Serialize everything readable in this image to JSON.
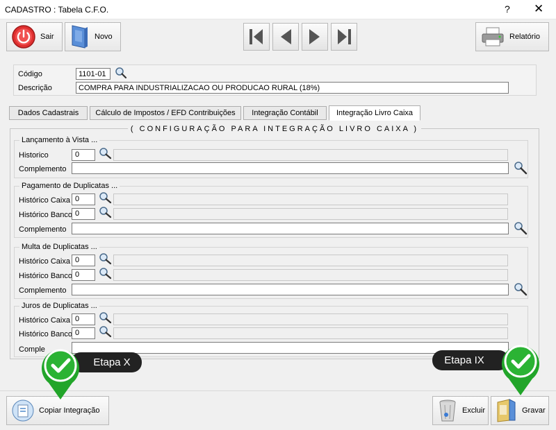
{
  "window": {
    "title": "CADASTRO : Tabela C.F.O.",
    "help_glyph": "?",
    "close_glyph": "✕"
  },
  "toolbar": {
    "sair_label": "Sair",
    "novo_label": "Novo",
    "relatorio_label": "Relatório"
  },
  "header": {
    "codigo_label": "Código",
    "codigo_value": "1101-01",
    "descricao_label": "Descrição",
    "descricao_value": "COMPRA PARA INDUSTRIALIZACAO OU PRODUCAO RURAL (18%)"
  },
  "tabs": [
    {
      "label": "Dados Cadastrais"
    },
    {
      "label": "Cálculo de Impostos / EFD Contribuições"
    },
    {
      "label": "Integração Contábil"
    },
    {
      "label": "Integração Livro Caixa"
    }
  ],
  "config_title": "( CONFIGURAÇÃO PARA INTEGRAÇÃO LIVRO CAIXA )",
  "groups": {
    "vista": {
      "title": "Lançamento à Vista ...",
      "historico_label": "Historico",
      "historico_value": "0",
      "complemento_label": "Complemento"
    },
    "pagamento": {
      "title": "Pagamento de Duplicatas ...",
      "caixa_label": "Histórico Caixa",
      "caixa_value": "0",
      "banco_label": "Histórico Banco",
      "banco_value": "0",
      "complemento_label": "Complemento"
    },
    "multa": {
      "title": "Multa de Duplicatas ...",
      "caixa_label": "Histórico Caixa",
      "caixa_value": "0",
      "banco_label": "Histórico Banco",
      "banco_value": "0",
      "complemento_label": "Complemento"
    },
    "juros": {
      "title": "Juros de Duplicatas ...",
      "caixa_label": "Histórico Caixa",
      "caixa_value": "0",
      "banco_label": "Histórico Banco",
      "banco_value": "0",
      "complemento_label": "Comple"
    }
  },
  "footer": {
    "copiar_label": "Copiar Integração",
    "excluir_label": "Excluir",
    "gravar_label": "Gravar"
  },
  "callouts": {
    "left_label": "Etapa X",
    "right_label": "Etapa IX"
  },
  "colors": {
    "callout_green": "#22a52a",
    "sair_red": "#e03030"
  }
}
